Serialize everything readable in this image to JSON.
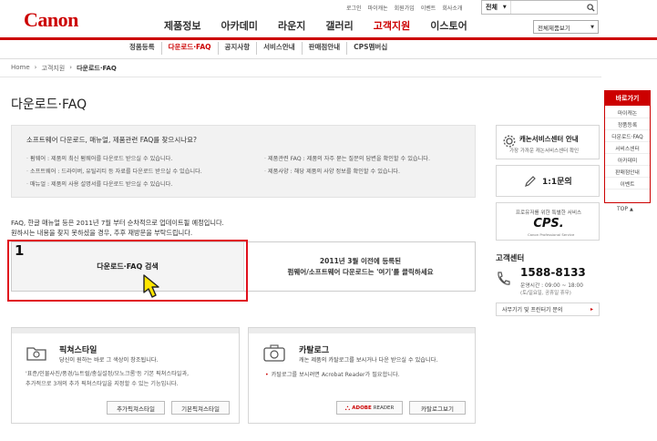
{
  "header": {
    "logo": "Canon",
    "util_links": [
      "로그인",
      "마이캐논",
      "회원가입",
      "이벤트",
      "회사소개"
    ],
    "search_scope": "전체",
    "all_products_label": "전체제품보기",
    "gnb": [
      "제품정보",
      "아카데미",
      "라운지",
      "갤러리",
      "고객지원",
      "이스토어"
    ],
    "gnb_active": "고객지원"
  },
  "lnb": {
    "items": [
      "정품등록",
      "다운로드·FAQ",
      "공지사항",
      "서비스안내",
      "판매점안내",
      "CPS멤버십"
    ],
    "active": "다운로드·FAQ"
  },
  "breadcrumb": {
    "home": "Home",
    "level1": "고객지원",
    "current": "다운로드·FAQ"
  },
  "page_title": "다운로드·FAQ",
  "intro": {
    "question": "소프트웨어 다운로드, 매뉴얼, 제품관련 FAQ를 찾으시나요?",
    "left": [
      "펌웨어 : 제품의 최신 펌웨어를 다운로드 받으실 수 있습니다.",
      "소프트웨어 : 드라이버, 유틸리티 등 자료를 다운로드 받으실 수 있습니다.",
      "매뉴얼 : 제품의 사용 설명서를 다운로드 받으실 수 있습니다."
    ],
    "right": [
      "제품관련 FAQ : 제품의 자주 묻는 질문의 답변을 확인할 수 있습니다.",
      "제품사양 : 해당 제품의 사양 정보를 확인할 수 있습니다."
    ]
  },
  "notice": {
    "line1": "FAQ, 한글 매뉴얼 등은 2011년 7월 부터 순차적으로 업데이트될 예정입니다.",
    "line2": "원하시는 내용을 찾지 못하셨을 경우, 추후 재방문을 부탁드립니다."
  },
  "download": {
    "search_label": "다운로드·FAQ 검색",
    "legacy_line1": "2011년 3월 이전에 등록된",
    "legacy_line2": "펌웨어/소프트웨어 다운로드는 '여기'를 클릭하세요",
    "highlight_number": "1"
  },
  "picture_style": {
    "title": "픽쳐스타일",
    "subtitle": "당신이 원하는 바로 그 색상이 창조됩니다.",
    "body1": "'표준/인물사진/풍경/뉴트럴/충실설정/모노크롬'등 기본 픽쳐스타일과,",
    "body2": "추가적으로 3개의 추가 픽쳐스타일을 지정할 수 있는 기능입니다.",
    "btn_add": "추가픽쳐스타일",
    "btn_basic": "기본픽쳐스타일"
  },
  "catalog": {
    "title": "카탈로그",
    "subtitle": "캐논 제품의 카탈로그를 보시거나 다운 받으실 수 있습니다.",
    "note": "카탈로그를 보시려면 Acrobat Reader가 필요합니다.",
    "btn_reader_brand": "ADOBE",
    "btn_reader_suffix": "READER",
    "btn_view": "카탈로그보기"
  },
  "sidebar": {
    "service_center_title": "캐논서비스센터 안내",
    "service_center_sub": "가장 가까운 캐논서비스센터 확인",
    "inquiry_label": "1:1문의",
    "cps_caption": "프로유저를 위한 특별한 서비스",
    "cps_logo": "CPS.",
    "cps_logo_sub": "Canon Professional Service",
    "cs_title": "고객센터",
    "phone": "1588-8133",
    "hours": "운영시간 : 09:00 ~ 18:00",
    "hours_note": "(토/일요일, 공휴일 휴무)",
    "site_link": "사무기기 및 프린터기 문의"
  },
  "quick_menu": {
    "title": "바로가기",
    "items": [
      "마이캐논",
      "정품등록",
      "다운로드·FAQ",
      "서비스센터",
      "아카데미",
      "판매점안내",
      "이벤트"
    ],
    "top": "TOP"
  },
  "colors": {
    "brand": "#cc0000",
    "highlight_border": "#e0101d",
    "arrow_fill": "#ffe600"
  }
}
